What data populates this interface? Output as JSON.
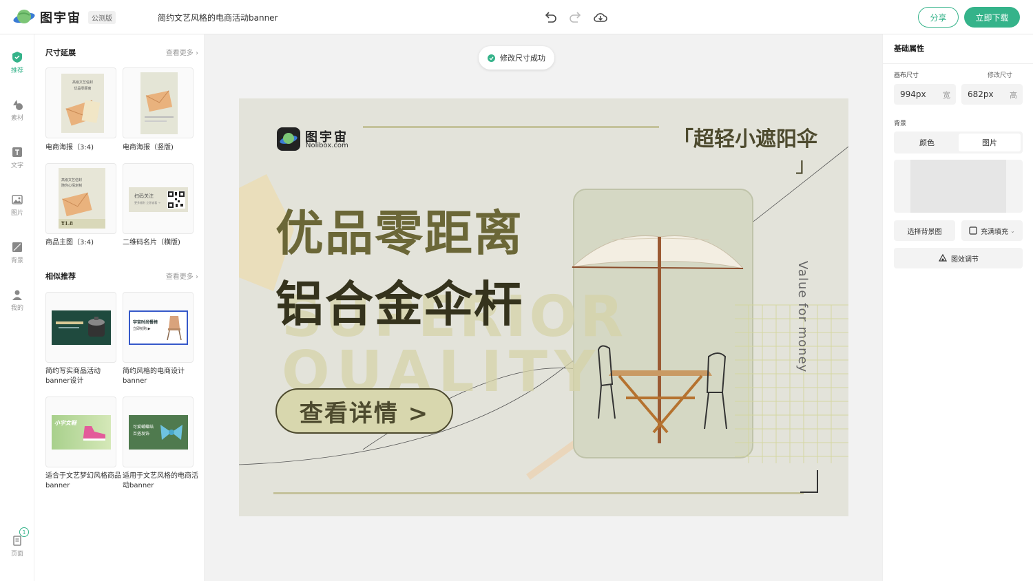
{
  "header": {
    "logo_text": "图宇宙",
    "beta_badge": "公测版",
    "doc_title": "简约文艺风格的电商活动banner",
    "share_label": "分享",
    "download_label": "立即下载",
    "accent": "#35b38a"
  },
  "rail": {
    "items": [
      {
        "label": "推荐",
        "icon": "recommend-icon"
      },
      {
        "label": "素材",
        "icon": "shapes-icon"
      },
      {
        "label": "文字",
        "icon": "text-icon"
      },
      {
        "label": "图片",
        "icon": "image-icon"
      },
      {
        "label": "背景",
        "icon": "background-icon"
      },
      {
        "label": "我的",
        "icon": "user-icon"
      }
    ],
    "pages_label": "页面",
    "pages_count": "1"
  },
  "left_panel": {
    "size_section": {
      "title": "尺寸延展",
      "more": "查看更多",
      "items": [
        {
          "caption": "电商海报（3:4)"
        },
        {
          "caption": "电商海报（竖版)"
        },
        {
          "caption": "商品主图（3:4)"
        },
        {
          "caption": "二维码名片（横版)"
        }
      ],
      "thumb_texts": {
        "poster1_title": "高级文艺信封",
        "poster1_sub": "优品零距离",
        "poster3_title": "高级文艺信封",
        "poster3_sub": "随你心情定制",
        "poster3_price": "¥1.8",
        "qr_title": "扫码关注",
        "qr_sub": "更多福利 立即查看 →"
      }
    },
    "similar_section": {
      "title": "相似推荐",
      "more": "查看更多",
      "items": [
        {
          "caption": "简约写实商品活动banner设计"
        },
        {
          "caption": "简约风格的电商设计banner"
        },
        {
          "caption": "适合于文艺梦幻风格商品banner"
        },
        {
          "caption": "适用于文艺风格的电商活动banner"
        }
      ],
      "thumb_texts": {
        "s2_title": "宇宙时尚餐椅",
        "s2_sub": "立即抢购 ▶",
        "s3_title": "小宇女鞋",
        "s4_title": "可爱蝴蝶结",
        "s4_sub": "百搭发饰"
      }
    }
  },
  "canvas": {
    "toast": "修改尺寸成功",
    "banner": {
      "brand_name": "图宇宙",
      "brand_url": "Nolibox.com",
      "tag_line": "「超轻小遮阳伞",
      "tag_close": "」",
      "headline1": "优品零距离",
      "headline2": "铝合金伞杆",
      "watermark1": "SUPERIOR",
      "watermark2": "QUALITY",
      "vertical_text": "Value for money",
      "cta": "查看详情 >"
    }
  },
  "right_panel": {
    "title": "基础属性",
    "canvas_size_label": "画布尺寸",
    "resize_label": "修改尺寸",
    "width_value": "994px",
    "width_unit": "宽",
    "height_value": "682px",
    "height_unit": "高",
    "background_label": "背景",
    "tab_color": "颜色",
    "tab_image": "图片",
    "choose_bg": "选择背景图",
    "fill_mode": "充满填充",
    "effect_adjust": "图效调节"
  }
}
